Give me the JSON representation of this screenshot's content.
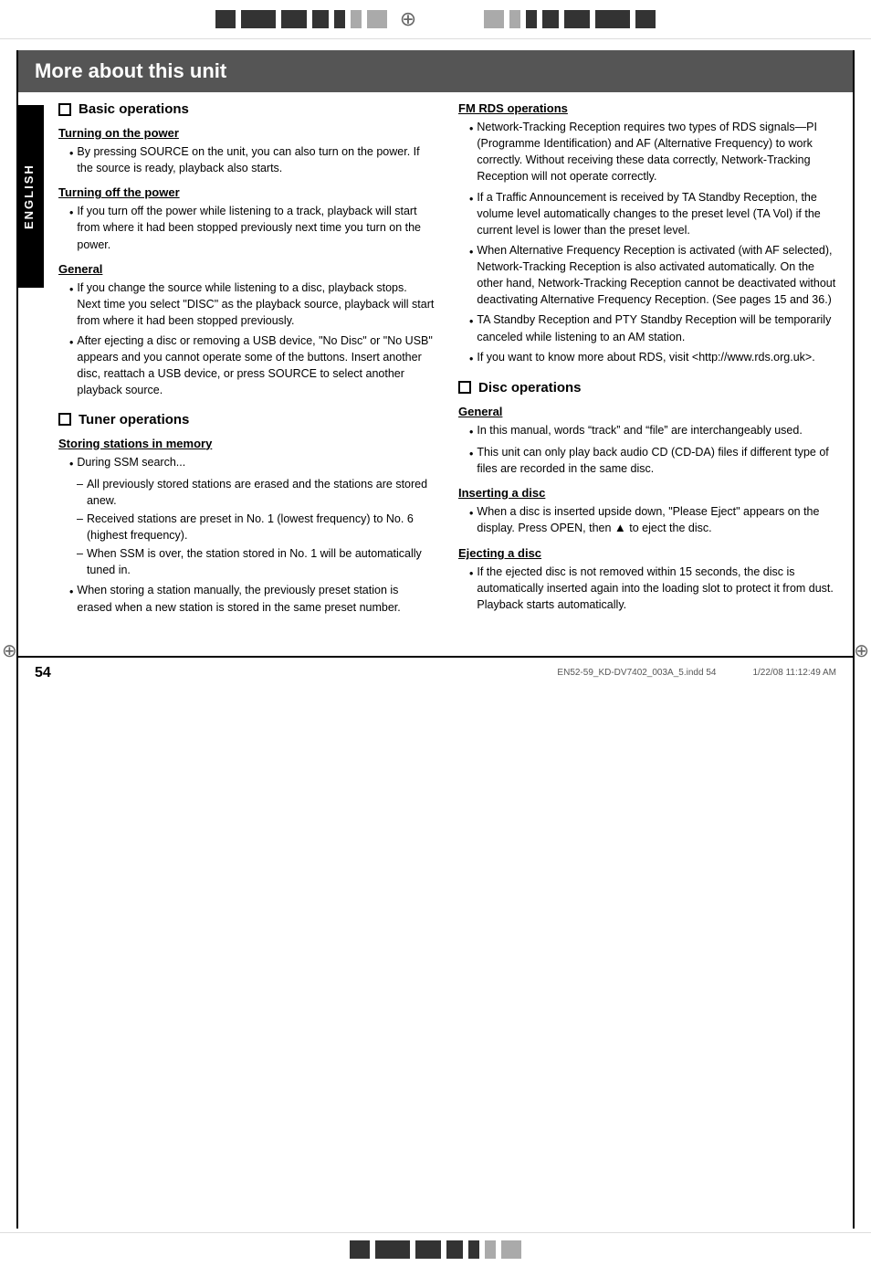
{
  "page": {
    "title": "More about this unit",
    "page_number": "54",
    "footer_text": "EN52-59_KD-DV7402_003A_5.indd   54",
    "footer_date": "1/22/08   11:12:49 AM",
    "language_label": "ENGLISH"
  },
  "left_column": {
    "section_basic": {
      "title": "Basic operations",
      "subsections": [
        {
          "title": "Turning on the power",
          "bullets": [
            "By pressing SOURCE on the unit, you can also turn on the power. If the source is ready, playback also starts."
          ]
        },
        {
          "title": "Turning off the power",
          "bullets": [
            "If you turn off the power while listening to a track, playback will start from where it had been stopped previously next time you turn on the power."
          ]
        },
        {
          "title": "General",
          "bullets": [
            "If you change the source while listening to a disc, playback stops.\nNext time you select “DISC” as the playback source, playback will start from where it had been stopped previously.",
            "After ejecting a disc or removing a USB device, “No Disc” or “No USB” appears and you cannot operate some of the buttons. Insert another disc, reattach a USB device, or press SOURCE to select another playback source."
          ]
        }
      ]
    },
    "section_tuner": {
      "title": "Tuner operations",
      "subsections": [
        {
          "title": "Storing stations in memory",
          "bullets": [
            {
              "text": "During SSM search...",
              "sub_items": [
                "All previously stored stations are erased and the stations are stored anew.",
                "Received stations are preset in No. 1 (lowest frequency) to No. 6 (highest frequency).",
                "When SSM is over, the station stored in No. 1 will be automatically tuned in."
              ]
            },
            {
              "text": "When storing a station manually, the previously preset station is erased when a new station is stored in the same preset number.",
              "sub_items": []
            }
          ]
        }
      ]
    }
  },
  "right_column": {
    "section_fm_rds": {
      "title": "FM RDS operations",
      "bullets": [
        "Network-Tracking Reception requires two types of RDS signals—PI (Programme Identification) and AF (Alternative Frequency) to work correctly. Without receiving these data correctly, Network-Tracking Reception will not operate correctly.",
        "If a Traffic Announcement is received by TA Standby Reception, the volume level automatically changes to the preset level (TA Vol) if the current level is lower than the preset level.",
        "When Alternative Frequency Reception is activated (with AF selected), Network-Tracking Reception is also activated automatically. On the other hand, Network-Tracking Reception cannot be deactivated without deactivating Alternative Frequency Reception. (See pages 15 and 36.)",
        "TA Standby Reception and PTY Standby Reception will be temporarily canceled while listening to an AM station.",
        "If you want to know more about RDS, visit <http://www.rds.org.uk>."
      ]
    },
    "section_disc": {
      "title": "Disc operations",
      "subsections": [
        {
          "title": "General",
          "bullets": [
            "In this manual, words “track” and “file” are interchangeably used.",
            "This unit can only play back audio CD (CD-DA) files if different type of files are recorded in the same disc."
          ]
        },
        {
          "title": "Inserting a disc",
          "bullets": [
            "When a disc is inserted upside down, “Please Eject” appears on the display. Press OPEN, then ▲ to eject the disc."
          ]
        },
        {
          "title": "Ejecting a disc",
          "bullets": [
            "If the ejected disc is not removed within 15 seconds, the disc is automatically inserted again into the loading slot to protect it from dust. Playback starts automatically."
          ]
        }
      ]
    }
  }
}
